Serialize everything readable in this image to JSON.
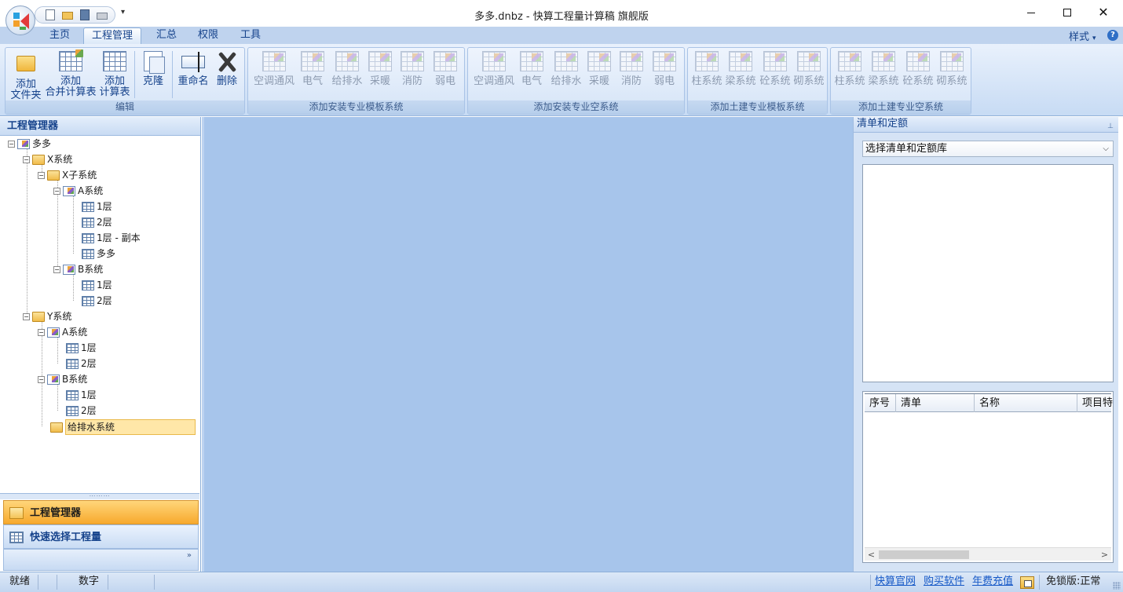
{
  "window": {
    "title": "多多.dnbz - 快算工程量计算稿 旗舰版",
    "minimize": "—",
    "maximize": "☐",
    "close": "✕"
  },
  "quick_access": {
    "dropdown": "▾",
    "icons": [
      "new-icon",
      "open-icon",
      "save-icon",
      "print-icon"
    ]
  },
  "ribbon_tabs": [
    {
      "label": "主页",
      "active": false
    },
    {
      "label": "工程管理",
      "active": true
    },
    {
      "label": "汇总",
      "active": false
    },
    {
      "label": "权限",
      "active": false
    },
    {
      "label": "工具",
      "active": false
    }
  ],
  "style_menu": {
    "label": "样式",
    "caret": "▾",
    "help": "?"
  },
  "ribbon_groups": {
    "edit": {
      "label": "编辑",
      "buttons": [
        {
          "line1": "添加",
          "line2": "文件夹",
          "icon": "folder-icon",
          "enabled": true
        },
        {
          "line1": "添加",
          "line2": "合并计算表",
          "icon": "merge-sheet-icon",
          "enabled": true
        },
        {
          "line1": "添加",
          "line2": "计算表",
          "icon": "sheet-icon",
          "enabled": true
        },
        {
          "line1": "克隆",
          "line2": "",
          "icon": "clone-icon",
          "enabled": true
        },
        {
          "line1": "重命名",
          "line2": "",
          "icon": "rename-icon",
          "enabled": true
        },
        {
          "line1": "删除",
          "line2": "",
          "icon": "delete-icon",
          "enabled": true
        }
      ]
    },
    "install_template": {
      "label": "添加安装专业模板系统",
      "buttons": [
        "空调通风",
        "电气",
        "给排水",
        "采暖",
        "消防",
        "弱电"
      ]
    },
    "install_empty": {
      "label": "添加安装专业空系统",
      "buttons": [
        "空调通风",
        "电气",
        "给排水",
        "采暖",
        "消防",
        "弱电"
      ]
    },
    "civil_template": {
      "label": "添加土建专业模板系统",
      "buttons": [
        "柱系统",
        "梁系统",
        "砼系统",
        "砌系统"
      ]
    },
    "civil_empty": {
      "label": "添加土建专业空系统",
      "buttons": [
        "柱系统",
        "梁系统",
        "砼系统",
        "砌系统"
      ]
    }
  },
  "left_panel": {
    "title": "工程管理器",
    "tree": [
      {
        "label": "多多",
        "icon": "system-icon",
        "expander": "−"
      },
      {
        "label": "X系统",
        "icon": "folder-icon",
        "expander": "−"
      },
      {
        "label": "X子系统",
        "icon": "folder-icon",
        "expander": "−"
      },
      {
        "label": "A系统",
        "icon": "system-icon",
        "expander": "−"
      },
      {
        "label": "1层",
        "icon": "sheet-icon",
        "expander": ""
      },
      {
        "label": "2层",
        "icon": "sheet-icon",
        "expander": ""
      },
      {
        "label": "1层 - 副本",
        "icon": "sheet-icon",
        "expander": ""
      },
      {
        "label": "多多",
        "icon": "sheet-icon",
        "expander": ""
      },
      {
        "label": "B系统",
        "icon": "system-icon",
        "expander": "−"
      },
      {
        "label": "1层",
        "icon": "sheet-icon",
        "expander": ""
      },
      {
        "label": "2层",
        "icon": "sheet-icon",
        "expander": ""
      },
      {
        "label": "Y系统",
        "icon": "folder-icon",
        "expander": "−"
      },
      {
        "label": "A系统",
        "icon": "system-icon",
        "expander": "−"
      },
      {
        "label": "1层",
        "icon": "sheet-icon",
        "expander": ""
      },
      {
        "label": "2层",
        "icon": "sheet-icon",
        "expander": ""
      },
      {
        "label": "B系统",
        "icon": "system-icon",
        "expander": "−"
      },
      {
        "label": "1层",
        "icon": "sheet-icon",
        "expander": ""
      },
      {
        "label": "2层",
        "icon": "sheet-icon",
        "expander": ""
      },
      {
        "label": "给排水系统",
        "icon": "folder-icon",
        "expander": "",
        "selected": true
      }
    ],
    "splitter": "⋯⋯⋯",
    "nav_project": "工程管理器",
    "nav_quick": "快速选择工程量",
    "nav_more": "»"
  },
  "right_panel": {
    "title": "清单和定额",
    "pin": "⊥",
    "select_placeholder": "选择清单和定额库",
    "select_caret": "⌵",
    "grid_columns": [
      "序号",
      "清单",
      "名称",
      "项目特征"
    ],
    "scroll_left": "<",
    "scroll_right": ">"
  },
  "status_bar": {
    "ready": "就绪",
    "numlock": "数字",
    "links": [
      "快算官网",
      "购买软件",
      "年费充值"
    ],
    "license": "免锁版:正常"
  }
}
